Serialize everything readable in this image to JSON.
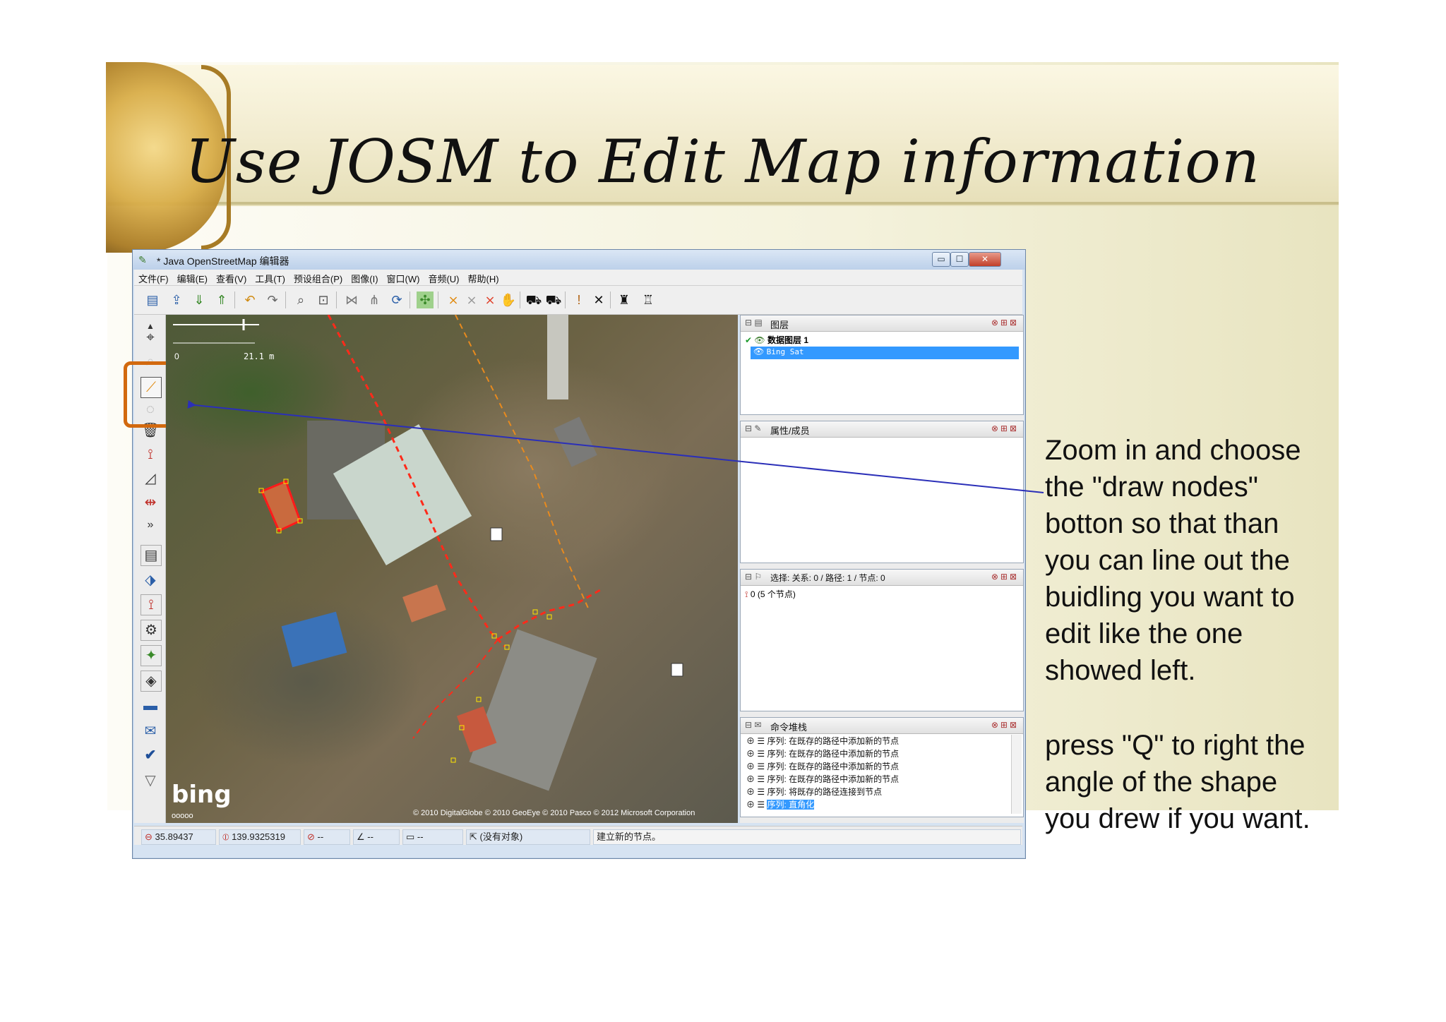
{
  "slide": {
    "title": "Use JOSM to Edit Map information",
    "note1_lines": [
      "Zoom in and choose",
      "the \"draw nodes\"",
      "botton so that than",
      "you can line out the",
      "buidling you want to",
      "edit like the one",
      "showed left."
    ],
    "note2_lines": [
      "press \"Q\" to right the",
      "angle of the shape",
      "you drew if you want."
    ]
  },
  "window": {
    "title": "* Java OpenStreetMap 编辑器",
    "controls": {
      "minimize": "▭",
      "maximize": "☐",
      "close": "✕"
    }
  },
  "menu": [
    "文件(F)",
    "编辑(E)",
    "查看(V)",
    "工具(T)",
    "预设组合(P)",
    "图像(I)",
    "窗口(W)",
    "音频(U)",
    "帮助(H)"
  ],
  "map": {
    "scale_start": "0",
    "scale_label": "21.1 m",
    "bing_logo": "bing",
    "bing_sub": "ooooo",
    "copyright": "© 2010 DigitalGlobe © 2010 GeoEye © 2010 Pasco © 2012 Microsoft Corporation"
  },
  "panels": {
    "layers": {
      "title": "图层",
      "layer1": "数据图层 1",
      "layer2": "Bing Sat"
    },
    "properties": {
      "title": "属性/成员"
    },
    "selection": {
      "title": "选择: 关系: 0 / 路径: 1 / 节点: 0",
      "item_num": "0",
      "item_label": "(5 个节点)"
    },
    "commands": {
      "title": "命令堆栈",
      "items": [
        "序列: 在既存的路径中添加新的节点",
        "序列: 在既存的路径中添加新的节点",
        "序列: 在既存的路径中添加新的节点",
        "序列: 在既存的路径中添加新的节点",
        "序列: 将既存的路径连接到节点",
        "序列: 直角化"
      ]
    }
  },
  "status": {
    "lat": "35.89437",
    "lon": "139.9325319",
    "heading": "--",
    "angle": "--",
    "distance": "--",
    "selection": "(没有对象)",
    "message": "建立新的节点。"
  },
  "colors": {
    "highlight": "#d2690f",
    "arrow": "#2b2fb8",
    "way": "#ff2a1a",
    "boundary": "#e88a1e"
  }
}
